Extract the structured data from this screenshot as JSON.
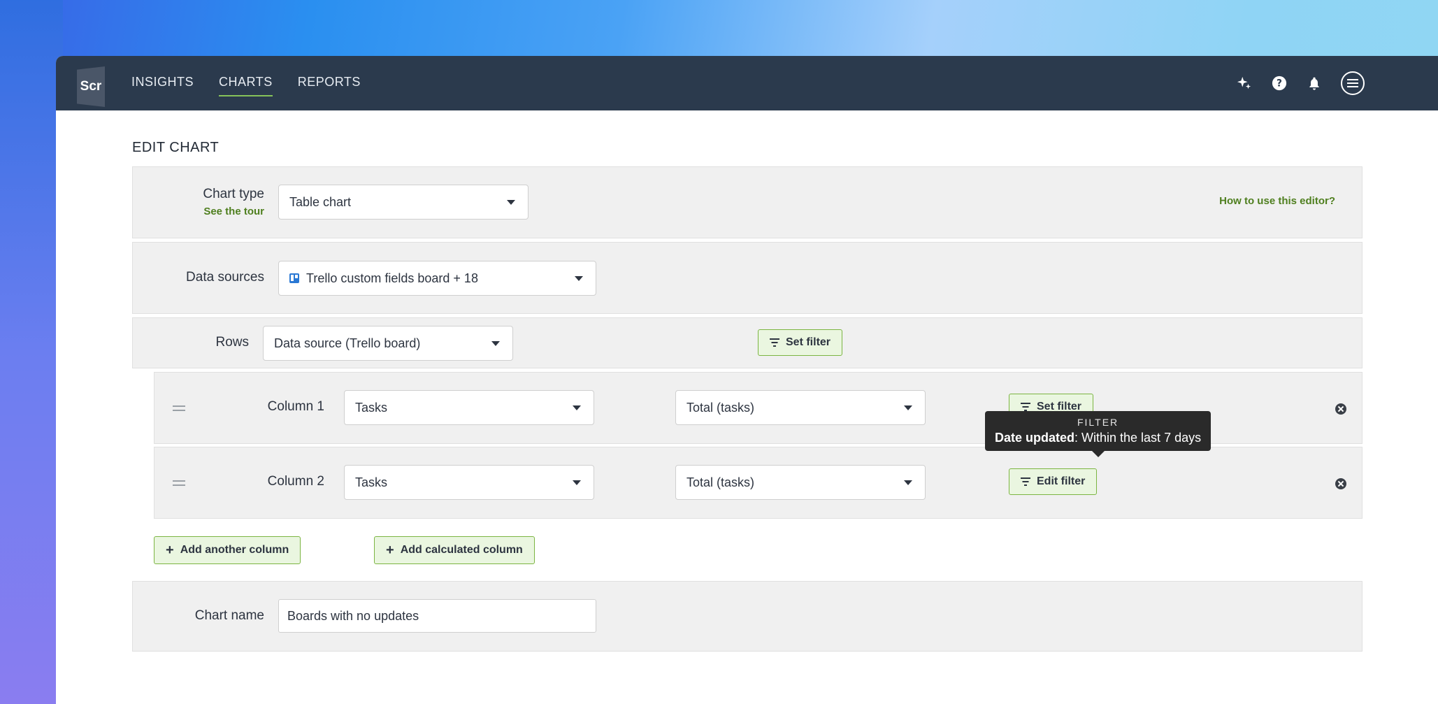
{
  "nav": {
    "logo": "Scr",
    "items": [
      {
        "label": "INSIGHTS",
        "active": false
      },
      {
        "label": "CHARTS",
        "active": true
      },
      {
        "label": "REPORTS",
        "active": false
      }
    ],
    "icons": [
      "sparkle-icon",
      "help-icon",
      "bell-icon",
      "menu-icon"
    ]
  },
  "page": {
    "title": "EDIT CHART"
  },
  "chart_type": {
    "label": "Chart type",
    "tour_link": "See the tour",
    "value": "Table chart",
    "help_link": "How to use this editor?"
  },
  "data_sources": {
    "label": "Data sources",
    "value": "Trello custom fields board + 18"
  },
  "rows": {
    "label": "Rows",
    "value": "Data source (Trello board)",
    "filter_button": "Set filter"
  },
  "columns": [
    {
      "label": "Column 1",
      "field": "Tasks",
      "aggregate": "Total (tasks)",
      "filter_button": "Set filter"
    },
    {
      "label": "Column 2",
      "field": "Tasks",
      "aggregate": "Total (tasks)",
      "filter_button": "Edit filter"
    }
  ],
  "tooltip": {
    "title": "FILTER",
    "key": "Date updated",
    "value": ": Within the last 7 days"
  },
  "actions": {
    "add_column": "Add another column",
    "add_calculated": "Add calculated column"
  },
  "chart_name": {
    "label": "Chart name",
    "value": "Boards with no updates"
  },
  "colors": {
    "topbar": "#2b3a4d",
    "accent_green": "#7cb542",
    "link_green": "#4f7f1f"
  }
}
